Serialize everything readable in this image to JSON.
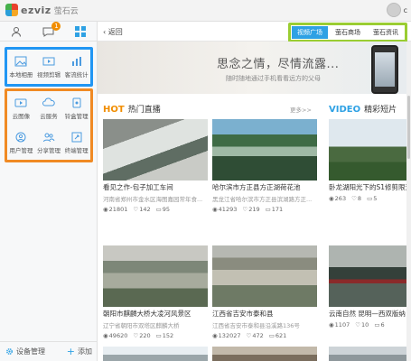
{
  "app": {
    "logo_text": "ezviz",
    "logo_cn": "萤石云",
    "user_label": "c"
  },
  "sidebar": {
    "tabs": [
      {
        "icon": "user-icon"
      },
      {
        "icon": "message-icon",
        "badge": "1"
      },
      {
        "icon": "apps-grid-icon"
      }
    ],
    "group_blue": [
      {
        "label": "本地相册",
        "icon": "photo-album-icon"
      },
      {
        "label": "视频剪辑",
        "icon": "video-edit-icon"
      },
      {
        "label": "客流统计",
        "icon": "traffic-stats-icon"
      }
    ],
    "group_orange": [
      {
        "label": "云图像",
        "icon": "cloud-image-icon"
      },
      {
        "label": "云服务",
        "icon": "cloud-service-icon"
      },
      {
        "label": "铃盒管理",
        "icon": "bell-manage-icon"
      },
      {
        "label": "用户管理",
        "icon": "user-manage-icon"
      },
      {
        "label": "分享管理",
        "icon": "share-manage-icon"
      },
      {
        "label": "终端管理",
        "icon": "terminal-manage-icon"
      }
    ],
    "bottom": {
      "device_manage": "设备管理",
      "add": "添加"
    }
  },
  "nav": {
    "back_label": "返回",
    "tabs": [
      {
        "label": "视频广场",
        "active": true
      },
      {
        "label": "萤石商场",
        "active": false
      },
      {
        "label": "萤石资讯",
        "active": false
      }
    ]
  },
  "banner": {
    "title": "思念之情，尽情流露...",
    "subtitle": "随时随地通过手机看看远方的父母"
  },
  "hot": {
    "en": "HOT",
    "cn": "热门直播",
    "more": "更多>>"
  },
  "video": {
    "en": "VIDEO",
    "cn": "精彩短片"
  },
  "hot_cards": [
    {
      "title": "看见之作-包子加工车间",
      "sub": "河南省郑州市金水区海图嘉园常年食...",
      "views": "21801",
      "likes": "142",
      "comments": "95"
    },
    {
      "title": "哈尔滨市方正县方正湖荷花池",
      "sub": "黑龙江省哈尔滨市方正县滨湖路方正...",
      "views": "41293",
      "likes": "219",
      "comments": "171"
    },
    {
      "title": "朝阳市麒麟大桥大凌河风景区",
      "sub": "辽宁省朝阳市双塔区麒麟大桥",
      "views": "49620",
      "likes": "220",
      "comments": "152"
    },
    {
      "title": "江西省吉安市泰和县",
      "sub": "江西省吉安市泰和县沿溪路136号",
      "views": "132027",
      "likes": "472",
      "comments": "621"
    }
  ],
  "video_cards": [
    {
      "title": "卧龙湖阳光下的S1修剪限速公路",
      "views": "263",
      "likes": "8",
      "comments": "5"
    },
    {
      "title": "云南自然 昆明—西双版纳",
      "views": "1107",
      "likes": "10",
      "comments": "6"
    }
  ]
}
